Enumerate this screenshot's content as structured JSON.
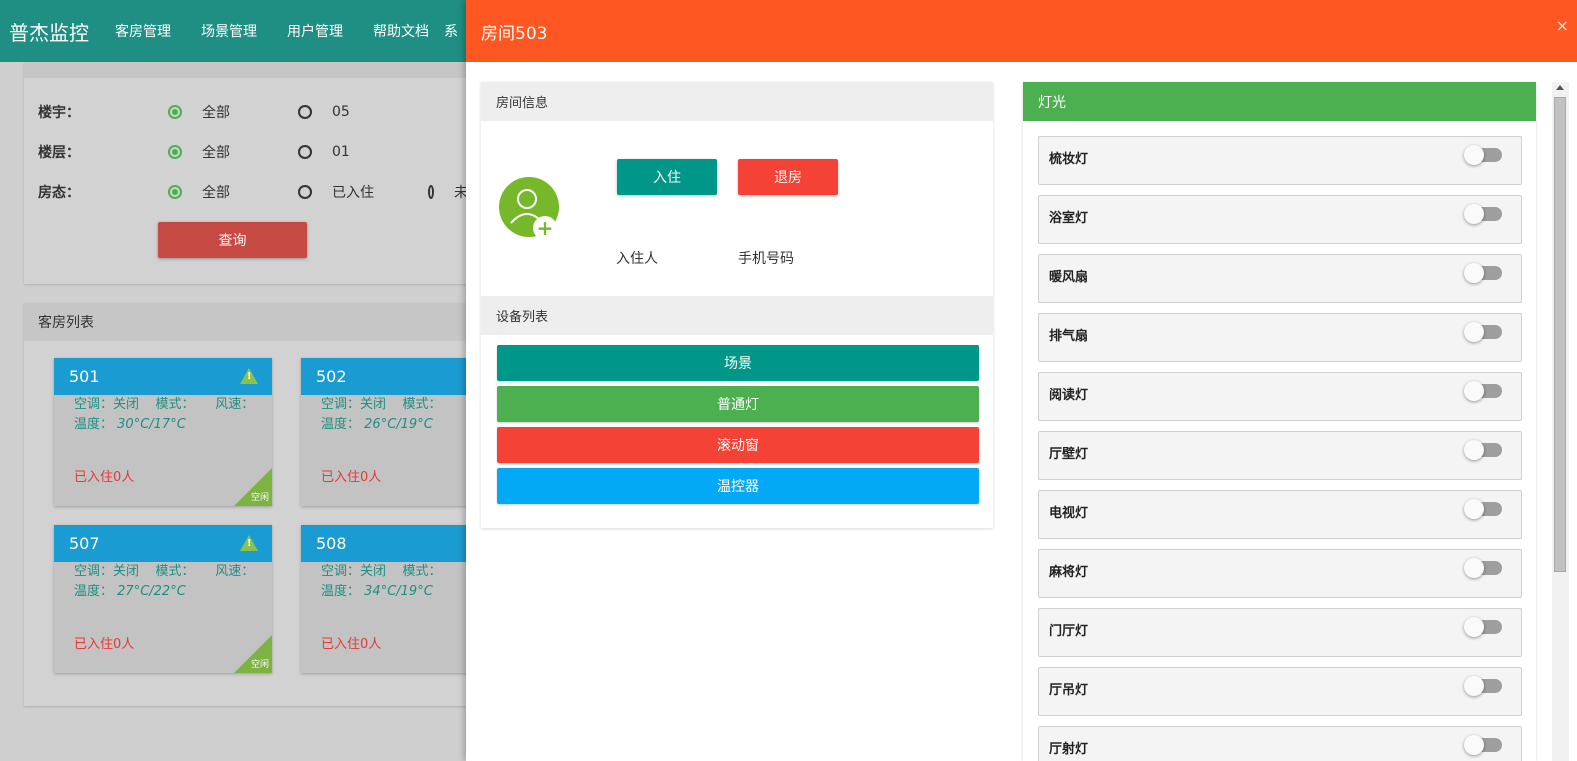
{
  "app": {
    "brand": "普杰监控",
    "nav": [
      "客房管理",
      "场景管理",
      "用户管理",
      "帮助文档",
      "系"
    ]
  },
  "filter": {
    "rows": [
      {
        "label": "楼宇：",
        "options": [
          {
            "text": "全部",
            "checked": true
          },
          {
            "text": "05",
            "checked": false
          }
        ]
      },
      {
        "label": "楼层：",
        "options": [
          {
            "text": "全部",
            "checked": true
          },
          {
            "text": "01",
            "checked": false
          }
        ]
      },
      {
        "label": "房态：",
        "options": [
          {
            "text": "全部",
            "checked": true
          },
          {
            "text": "已入住",
            "checked": false
          },
          {
            "text": "未",
            "checked": false
          }
        ]
      }
    ],
    "query_label": "查询"
  },
  "room_list": {
    "title": "客房列表",
    "rooms": [
      {
        "number": "501",
        "ac": "空调：关闭",
        "mode": "模式：",
        "speed": "风速：",
        "temp_label": "温度：",
        "temp": "30°C/17°C",
        "occupancy": "已入住0人",
        "status": "空闲",
        "warning": true
      },
      {
        "number": "502",
        "ac": "空调：关闭",
        "mode": "模式：",
        "speed": "",
        "temp_label": "温度：",
        "temp": "26°C/19°C",
        "occupancy": "已入住0人",
        "status": "",
        "warning": false
      },
      {
        "number": "507",
        "ac": "空调：关闭",
        "mode": "模式：",
        "speed": "风速：",
        "temp_label": "温度：",
        "temp": "27°C/22°C",
        "occupancy": "已入住0人",
        "status": "空闲",
        "warning": true
      },
      {
        "number": "508",
        "ac": "空调：关闭",
        "mode": "模式：",
        "speed": "",
        "temp_label": "温度：",
        "temp": "34°C/19°C",
        "occupancy": "已入住0人",
        "status": "",
        "warning": false
      }
    ]
  },
  "modal": {
    "title": "房间503",
    "close": "×",
    "room_info": {
      "title": "房间信息",
      "checkin_label": "入住",
      "checkout_label": "退房",
      "guest_label": "入住人",
      "phone_label": "手机号码"
    },
    "devices": {
      "title": "设备列表",
      "buttons": [
        {
          "label": "场景",
          "color": "#009688"
        },
        {
          "label": "普通灯",
          "color": "#4caf50"
        },
        {
          "label": "滚动窗",
          "color": "#f44336"
        },
        {
          "label": "温控器",
          "color": "#03a9f4"
        }
      ]
    },
    "lights": {
      "title": "灯光",
      "items": [
        {
          "name": "梳妆灯",
          "on": false
        },
        {
          "name": "浴室灯",
          "on": false
        },
        {
          "name": "暖风扇",
          "on": false
        },
        {
          "name": "排气扇",
          "on": false
        },
        {
          "name": "阅读灯",
          "on": false
        },
        {
          "name": "厅壁灯",
          "on": false
        },
        {
          "name": "电视灯",
          "on": false
        },
        {
          "name": "麻将灯",
          "on": false
        },
        {
          "name": "门厅灯",
          "on": false
        },
        {
          "name": "厅吊灯",
          "on": false
        },
        {
          "name": "厅射灯",
          "on": false
        }
      ]
    }
  }
}
